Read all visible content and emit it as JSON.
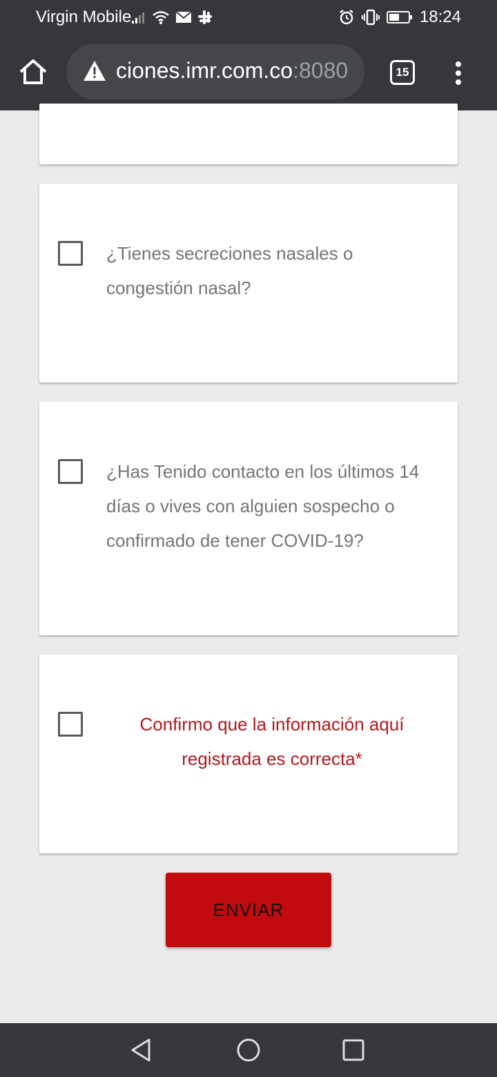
{
  "status_bar": {
    "carrier": "Virgin Mobile",
    "time": "18:24",
    "icons": [
      "signal-icon",
      "wifi-icon",
      "mail-icon",
      "slack-icon",
      "alarm-icon",
      "vibrate-icon",
      "battery-icon"
    ]
  },
  "browser": {
    "url_host": "ciones.imr.com.co",
    "url_port": ":8080",
    "tab_count": "15",
    "security": "not-secure-warning"
  },
  "form": {
    "questions": [
      {
        "label": "¿Tienes secreciones nasales o congestión nasal?",
        "checked": false
      },
      {
        "label": "¿Has Tenido contacto en los últimos 14 días o vives con alguien sospecho o confirmado de tener COVID-19?",
        "checked": false
      }
    ],
    "confirmation": {
      "label": "Confirmo que la información aquí registrada es correcta*",
      "checked": false
    },
    "submit_label": "ENVIAR"
  },
  "colors": {
    "chrome_bg": "#36373b",
    "page_bg": "#ebebeb",
    "accent_red": "#c20b0e",
    "confirm_text": "#b3181c",
    "question_text": "#757575"
  }
}
